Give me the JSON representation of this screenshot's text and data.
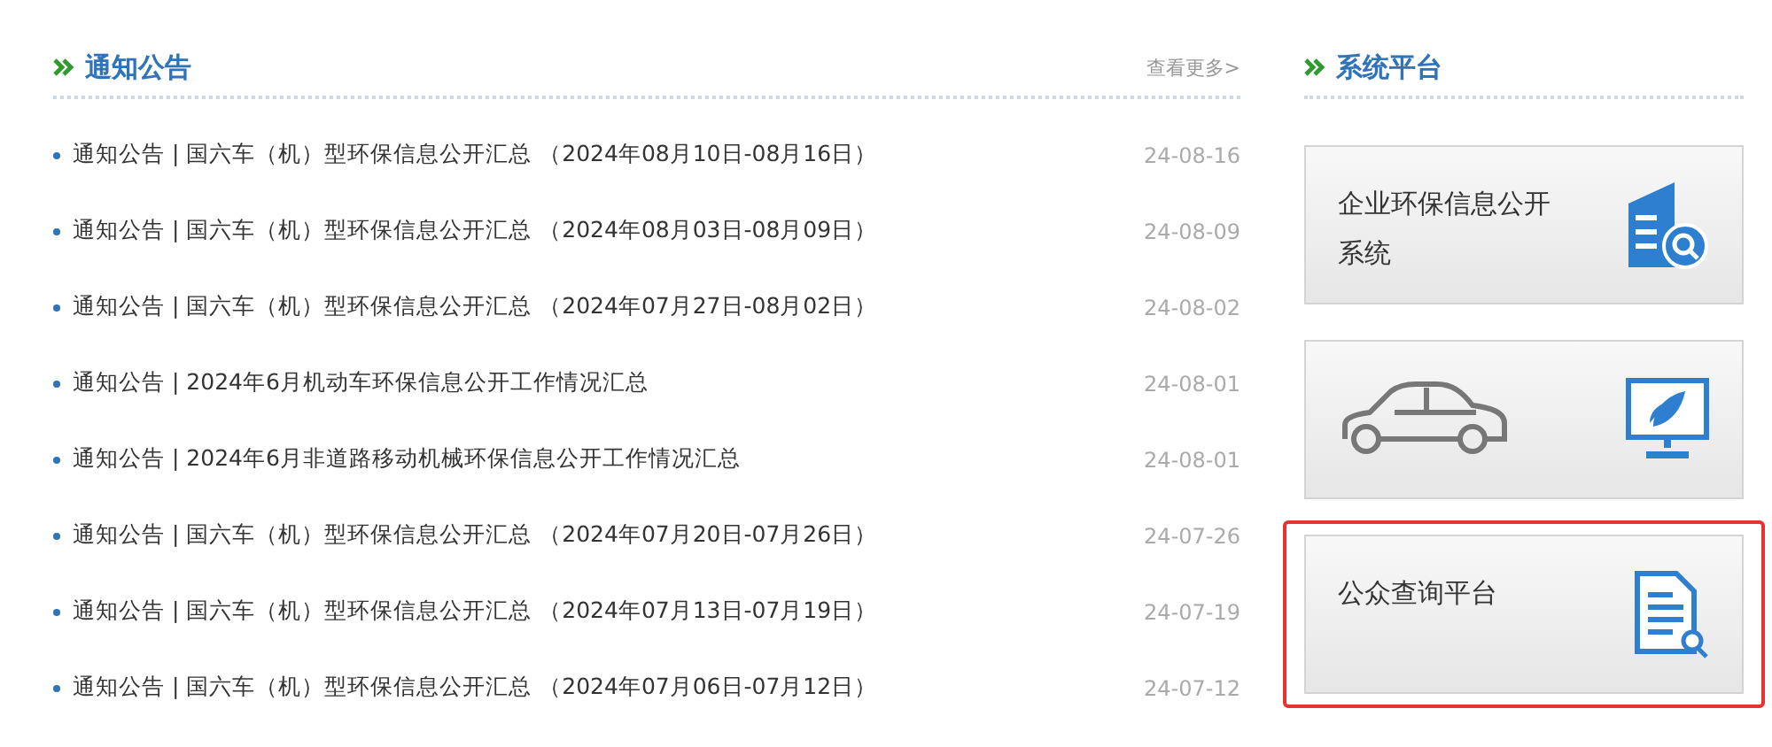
{
  "notices": {
    "title": "通知公告",
    "more": "查看更多>",
    "items": [
      {
        "text": "通知公告 | 国六车（机）型环保信息公开汇总 （2024年08月10日-08月16日）",
        "date": "24-08-16"
      },
      {
        "text": "通知公告 | 国六车（机）型环保信息公开汇总 （2024年08月03日-08月09日）",
        "date": "24-08-09"
      },
      {
        "text": "通知公告 | 国六车（机）型环保信息公开汇总 （2024年07月27日-08月02日）",
        "date": "24-08-02"
      },
      {
        "text": "通知公告 | 2024年6月机动车环保信息公开工作情况汇总",
        "date": "24-08-01"
      },
      {
        "text": "通知公告 | 2024年6月非道路移动机械环保信息公开工作情况汇总",
        "date": "24-08-01"
      },
      {
        "text": "通知公告 | 国六车（机）型环保信息公开汇总 （2024年07月20日-07月26日）",
        "date": "24-07-26"
      },
      {
        "text": "通知公告 | 国六车（机）型环保信息公开汇总 （2024年07月13日-07月19日）",
        "date": "24-07-19"
      },
      {
        "text": "通知公告 | 国六车（机）型环保信息公开汇总 （2024年07月06日-07月12日）",
        "date": "24-07-12"
      }
    ]
  },
  "platforms": {
    "title": "系统平台",
    "items": [
      {
        "kind": "building",
        "label": "企业环保信息公开系统",
        "highlighted": false
      },
      {
        "kind": "car",
        "highlighted": false
      },
      {
        "kind": "document",
        "label": "公众查询平台",
        "highlighted": true
      }
    ]
  }
}
